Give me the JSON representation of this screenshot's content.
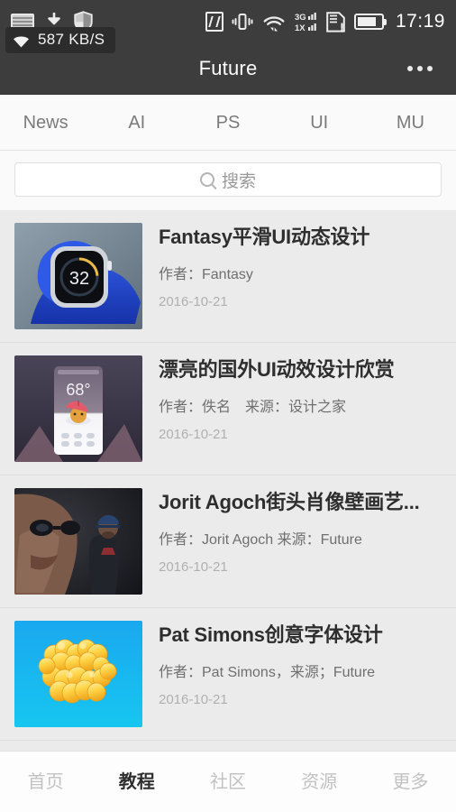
{
  "statusbar": {
    "time": "17:19",
    "network_speed": "587 KB/S",
    "left_icons": [
      "screenshot-icon",
      "download-icon",
      "shield-icon"
    ],
    "right_icons": [
      "nfc-icon",
      "vibrate-icon",
      "wifi-icon",
      "signal-3g-icon",
      "sim-card-icon",
      "battery-icon"
    ],
    "signal_labels": {
      "top": "3G",
      "bottom": "1X"
    }
  },
  "header": {
    "title": "Future",
    "more_label": "more-options"
  },
  "category_tabs": [
    {
      "label": "News",
      "active": false
    },
    {
      "label": "AI",
      "active": false
    },
    {
      "label": "PS",
      "active": false
    },
    {
      "label": "UI",
      "active": false
    },
    {
      "label": "MU",
      "active": false
    }
  ],
  "search": {
    "placeholder": "搜索",
    "value": ""
  },
  "articles": [
    {
      "title": "Fantasy平滑UI动态设计",
      "subtitle": "作者：Fantasy",
      "date": "2016-10-21",
      "thumb": "smartwatch-blue-band"
    },
    {
      "title": "漂亮的国外UI动效设计欣赏",
      "subtitle": "作者：佚名　来源：设计之家",
      "date": "2016-10-21",
      "thumb": "weather-app-mockup"
    },
    {
      "title": "Jorit Agoch街头肖像壁画艺...",
      "subtitle": "作者：Jorit Agoch 来源：Future",
      "date": "2016-10-21",
      "thumb": "street-portrait-mural"
    },
    {
      "title": "Pat Simons创意字体设计",
      "subtitle": "作者：Pat Simons，来源；Future",
      "date": "2016-10-21",
      "thumb": "yellow-3d-lettering"
    }
  ],
  "bottom_nav": [
    {
      "label": "首页",
      "active": false
    },
    {
      "label": "教程",
      "active": true
    },
    {
      "label": "社区",
      "active": false
    },
    {
      "label": "资源",
      "active": false
    },
    {
      "label": "更多",
      "active": false
    }
  ],
  "colors": {
    "header_bg": "#3d3d3d",
    "page_bg": "#ebebeb",
    "tabs_bg": "#fafafa",
    "accent_text": "#2e2e2e",
    "muted_text": "#b0b0b0"
  }
}
